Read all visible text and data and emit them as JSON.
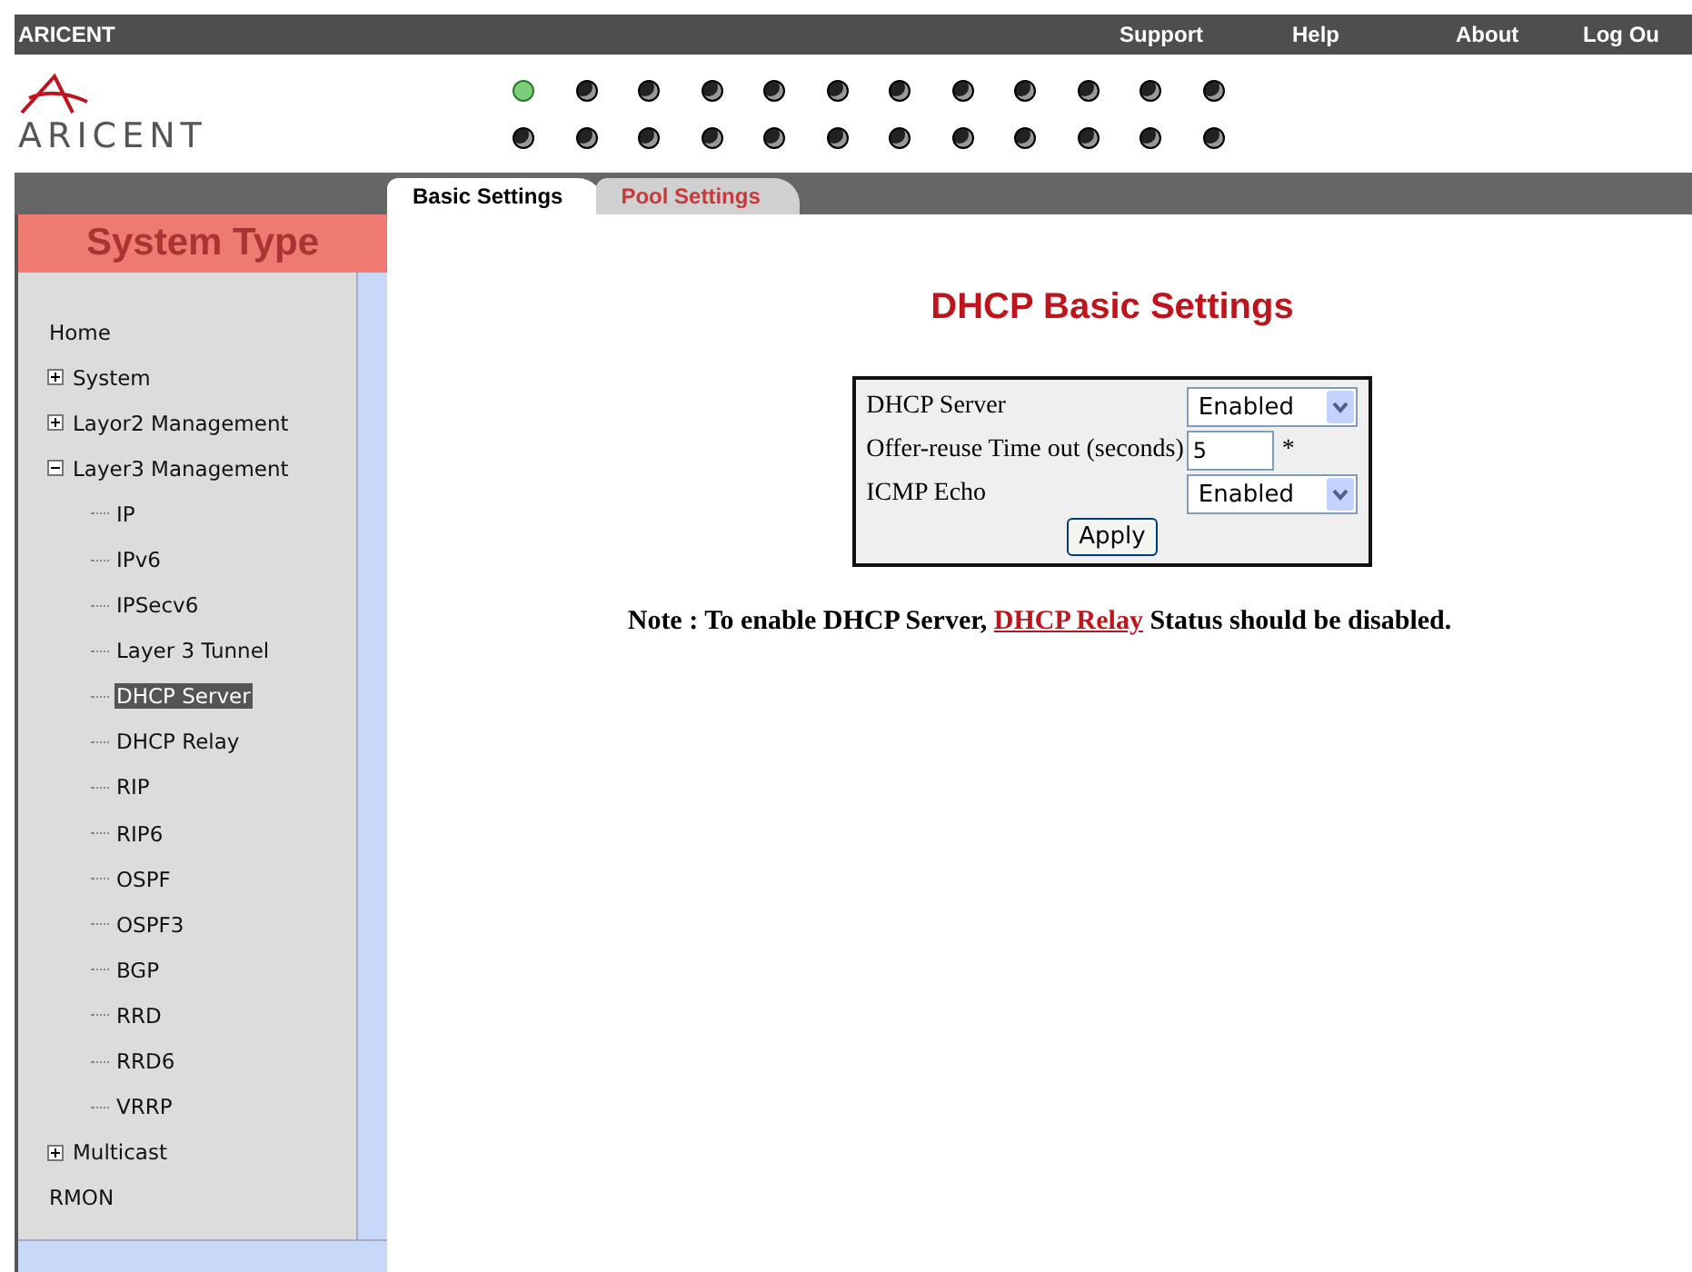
{
  "top_bar": {
    "brand": "ARICENT",
    "links": [
      "Support",
      "Help",
      "About",
      "Log Ou"
    ]
  },
  "logo": {
    "text": "ARICENT"
  },
  "ports": [
    {
      "active": true
    },
    {
      "active": false
    },
    {
      "active": false
    },
    {
      "active": false
    },
    {
      "active": false
    },
    {
      "active": false
    },
    {
      "active": false
    },
    {
      "active": false
    },
    {
      "active": false
    },
    {
      "active": false
    },
    {
      "active": false
    },
    {
      "active": false
    },
    {
      "active": false
    },
    {
      "active": false
    },
    {
      "active": false
    },
    {
      "active": false
    },
    {
      "active": false
    },
    {
      "active": false
    },
    {
      "active": false
    },
    {
      "active": false
    },
    {
      "active": false
    },
    {
      "active": false
    },
    {
      "active": false
    },
    {
      "active": false
    }
  ],
  "tabs": [
    {
      "label": "Basic Settings",
      "selected": true
    },
    {
      "label": "Pool Settings",
      "selected": false
    }
  ],
  "sidebar": {
    "title": "System Type",
    "tree": [
      {
        "label": "Home",
        "selected": false
      },
      {
        "label": "System",
        "selected": false,
        "expanded": false
      },
      {
        "label": "Layor2 Management",
        "selected": false,
        "expanded": false
      },
      {
        "label": "Layer3 Management",
        "selected": false,
        "expanded": true,
        "children": [
          {
            "label": "IP",
            "selected": false
          },
          {
            "label": "IPv6",
            "selected": false
          },
          {
            "label": "IPSecv6",
            "selected": false
          },
          {
            "label": "Layer 3 Tunnel",
            "selected": false
          },
          {
            "label": "DHCP Server",
            "selected": true
          },
          {
            "label": "DHCP Relay",
            "selected": false
          },
          {
            "label": "RIP",
            "selected": false
          },
          {
            "label": "RIP6",
            "selected": false
          },
          {
            "label": "OSPF",
            "selected": false
          },
          {
            "label": "OSPF3",
            "selected": false
          },
          {
            "label": "BGP",
            "selected": false
          },
          {
            "label": "RRD",
            "selected": false
          },
          {
            "label": "RRD6",
            "selected": false
          },
          {
            "label": "VRRP",
            "selected": false
          }
        ]
      },
      {
        "label": "Multicast",
        "selected": false,
        "expanded": false
      },
      {
        "label": "RMON",
        "selected": false
      }
    ]
  },
  "page": {
    "title": "DHCP Basic Settings",
    "fields": [
      {
        "kind": "select",
        "label": "DHCP Server",
        "value": "Enabled"
      },
      {
        "kind": "input",
        "label": "Offer-reuse Time out (seconds)",
        "value": "5",
        "required_mark": "*"
      },
      {
        "kind": "select",
        "label": "ICMP Echo",
        "value": "Enabled"
      }
    ],
    "apply": "Apply",
    "note": {
      "before": "Note : To enable DHCP Server, ",
      "link": "DHCP Relay",
      "after": " Status should be disabled."
    }
  }
}
